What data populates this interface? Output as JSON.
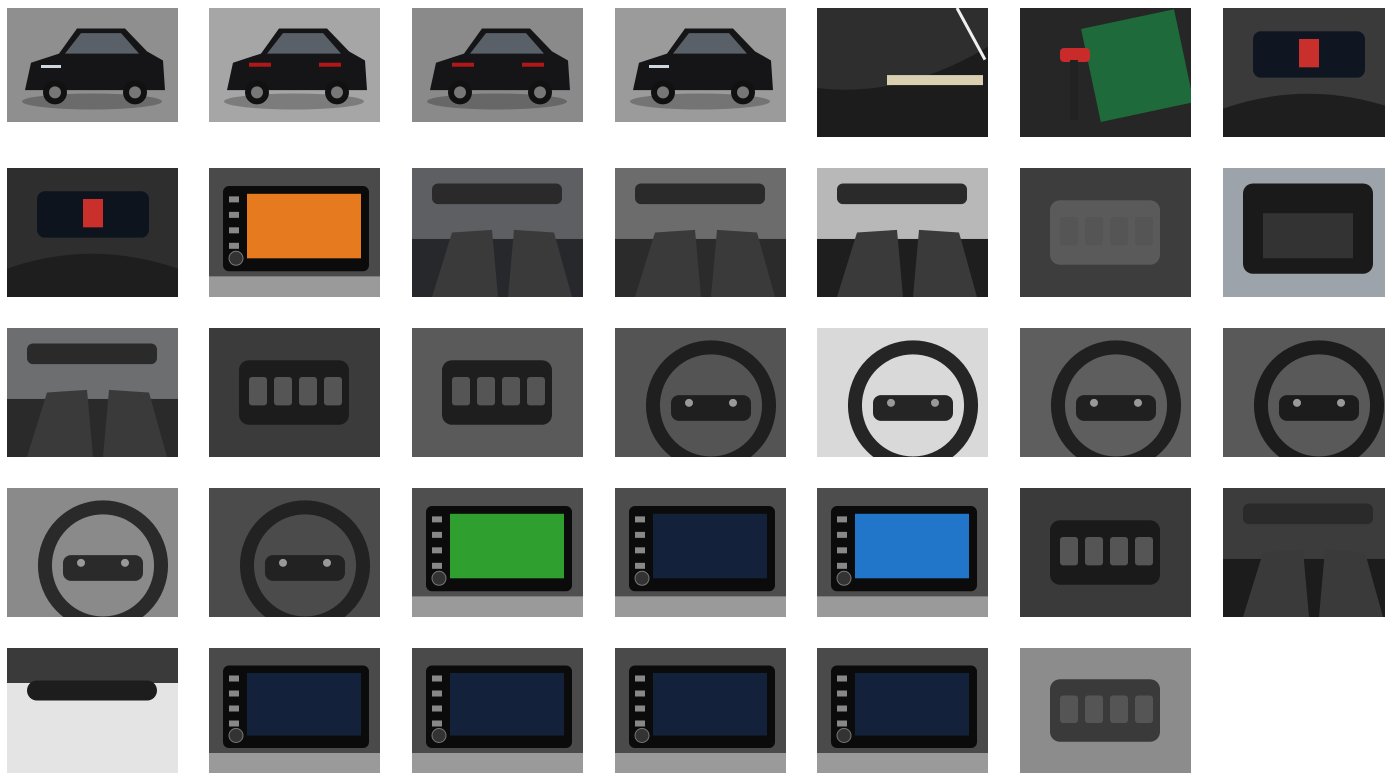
{
  "gallery": {
    "photos": [
      {
        "subject": "exterior-front-three-quarter",
        "bg": "#8f8f8f",
        "accent": "#151518"
      },
      {
        "subject": "exterior-rear-three-quarter",
        "bg": "#a6a6a6",
        "accent": "#151518"
      },
      {
        "subject": "exterior-rear",
        "bg": "#8a8a8a",
        "accent": "#151518"
      },
      {
        "subject": "exterior-front-side",
        "bg": "#9b9b9b",
        "accent": "#151518"
      },
      {
        "subject": "vin-plate-windshield",
        "bg": "#1c1c1c",
        "accent": "#d8d0b0"
      },
      {
        "subject": "keys-and-manual",
        "bg": "#262626",
        "accent": "#c92a2a"
      },
      {
        "subject": "instrument-cluster",
        "bg": "#3a3a3a",
        "accent": "#0f1622"
      },
      {
        "subject": "instrument-cluster-close",
        "bg": "#2e2e2e",
        "accent": "#0d141d"
      },
      {
        "subject": "infotainment-parking-view",
        "bg": "#4a4a4a",
        "accent": "#e67a1e"
      },
      {
        "subject": "driver-door-open-interior",
        "bg": "#5d5f63",
        "accent": "#26282c"
      },
      {
        "subject": "rear-seats",
        "bg": "#6c6c6c",
        "accent": "#2b2b2b"
      },
      {
        "subject": "dashboard-overview",
        "bg": "#b8b8b8",
        "accent": "#1e1e1e"
      },
      {
        "subject": "rear-vents-center-console",
        "bg": "#3d3d3d",
        "accent": "#5a5a5a"
      },
      {
        "subject": "open-trunk",
        "bg": "#9ca3aa",
        "accent": "#1a1a1a"
      },
      {
        "subject": "interior-from-door",
        "bg": "#6d6e70",
        "accent": "#2a2a2a"
      },
      {
        "subject": "window-switches",
        "bg": "#3b3b3b",
        "accent": "#1c1c1c"
      },
      {
        "subject": "light-switch-panel",
        "bg": "#5a5a5a",
        "accent": "#1e1e1e"
      },
      {
        "subject": "steering-wheel-left-buttons",
        "bg": "#545454",
        "accent": "#1f1f1f"
      },
      {
        "subject": "wiper-stalk",
        "bg": "#d9d9d9",
        "accent": "#252525"
      },
      {
        "subject": "cluster-and-stalks",
        "bg": "#5e5e5e",
        "accent": "#202020"
      },
      {
        "subject": "right-stalk-close",
        "bg": "#595959",
        "accent": "#1c1c1c"
      },
      {
        "subject": "steering-wheel-full",
        "bg": "#8a8a8a",
        "accent": "#2a2a2a"
      },
      {
        "subject": "steering-wheel-logo",
        "bg": "#4b4b4b",
        "accent": "#222222"
      },
      {
        "subject": "infotainment-navigation-map",
        "bg": "#4f4f4f",
        "accent": "#2f9f2f"
      },
      {
        "subject": "infotainment-smartlink",
        "bg": "#4d4d4d",
        "accent": "#14213a"
      },
      {
        "subject": "infotainment-apps-grid",
        "bg": "#4d4d4d",
        "accent": "#2176c9"
      },
      {
        "subject": "climate-controls-gear-lever",
        "bg": "#3a3a3a",
        "accent": "#1a1a1a"
      },
      {
        "subject": "gear-lever-seats",
        "bg": "#3c3c3c",
        "accent": "#1c1c1c"
      },
      {
        "subject": "rear-view-mirror",
        "bg": "#e4e4e4",
        "accent": "#1d1d1d"
      },
      {
        "subject": "infotainment-phone-screen",
        "bg": "#4a4a4a",
        "accent": "#14213a"
      },
      {
        "subject": "infotainment-media-screen",
        "bg": "#4a4a4a",
        "accent": "#14213a"
      },
      {
        "subject": "infotainment-radio-screen",
        "bg": "#4a4a4a",
        "accent": "#14213a"
      },
      {
        "subject": "infotainment-settings-list",
        "bg": "#4a4a4a",
        "accent": "#14213a"
      },
      {
        "subject": "overhead-console",
        "bg": "#8c8c8c",
        "accent": "#3a3a3a"
      }
    ]
  }
}
